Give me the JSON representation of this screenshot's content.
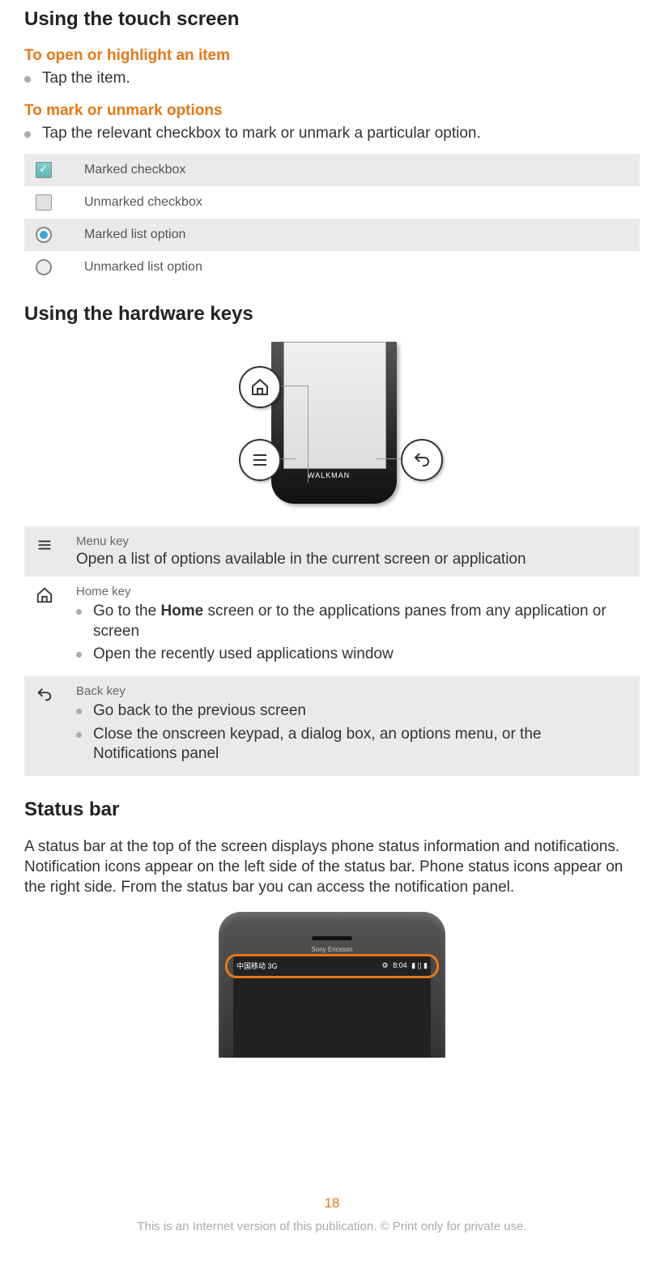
{
  "sections": {
    "touch": {
      "heading": "Using the touch screen",
      "open": {
        "title": "To open or highlight an item",
        "bullet": "Tap the item."
      },
      "mark": {
        "title": "To mark or unmark options",
        "bullet": "Tap the relevant checkbox to mark or unmark a particular option."
      },
      "legend": {
        "marked_cb": "Marked checkbox",
        "unmarked_cb": "Unmarked checkbox",
        "marked_radio": "Marked list option",
        "unmarked_radio": "Unmarked list option"
      }
    },
    "hardware": {
      "heading": "Using the hardware keys",
      "phone_logo": "WALKMAN",
      "menu": {
        "title": "Menu key",
        "desc": "Open a list of options available in the current screen or application"
      },
      "home": {
        "title": "Home key",
        "b1_pre": "Go to the ",
        "b1_bold": "Home",
        "b1_post": " screen or to the applications panes from any application or screen",
        "b2": "Open the recently used applications window"
      },
      "back": {
        "title": "Back key",
        "b1": "Go back to the previous screen",
        "b2": "Close the onscreen keypad, a dialog box, an options menu, or the Notifications panel"
      }
    },
    "status": {
      "heading": "Status bar",
      "para": "A status bar at the top of the screen displays phone status information and notifications. Notification icons appear on the left side of the status bar. Phone status icons appear on the right side. From the status bar you can access the notification panel.",
      "brand": "Sony Ericsson",
      "left_text": "中国移动 3G",
      "right_text": "8:04"
    }
  },
  "page_number": "18",
  "footer": "This is an Internet version of this publication. © Print only for private use."
}
